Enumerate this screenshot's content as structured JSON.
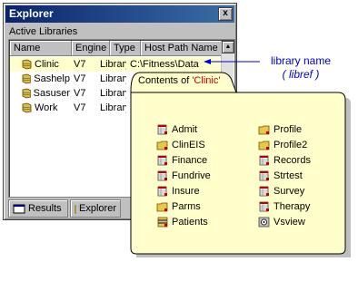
{
  "window": {
    "title": "Explorer",
    "close_glyph": "x",
    "pane_label": "Active Libraries"
  },
  "columns": [
    "Name",
    "Engine",
    "Type",
    "Host Path Name"
  ],
  "libraries": [
    {
      "name": "Clinic",
      "engine": "V7",
      "type": "Library",
      "host_path": "C:\\Fitness\\Data",
      "selected": true
    },
    {
      "name": "Sashelp",
      "engine": "V7",
      "type": "Library",
      "host_path": "",
      "selected": false
    },
    {
      "name": "Sasuser",
      "engine": "V7",
      "type": "Library",
      "host_path": "",
      "selected": false
    },
    {
      "name": "Work",
      "engine": "V7",
      "type": "Library",
      "host_path": "",
      "selected": false
    }
  ],
  "tabs": [
    {
      "label": "Results",
      "icon": "results-icon"
    },
    {
      "label": "Explorer",
      "icon": "explorer-icon"
    }
  ],
  "annotation": {
    "line1": "library name",
    "line2": "( libref )"
  },
  "contents": {
    "tab_prefix": "Contents of ",
    "libname": "'Clinic'",
    "left_column": [
      {
        "name": "Admit",
        "icon": "dataset-icon"
      },
      {
        "name": "ClinEIS",
        "icon": "folder-icon"
      },
      {
        "name": "Finance",
        "icon": "dataset-icon"
      },
      {
        "name": "Fundrive",
        "icon": "dataset-icon"
      },
      {
        "name": "Insure",
        "icon": "dataset-icon"
      },
      {
        "name": "Parms",
        "icon": "folder-icon"
      },
      {
        "name": "Patients",
        "icon": "catalog-icon"
      }
    ],
    "right_column": [
      {
        "name": "Profile",
        "icon": "folder-icon"
      },
      {
        "name": "Profile2",
        "icon": "folder-icon"
      },
      {
        "name": "Records",
        "icon": "dataset-icon"
      },
      {
        "name": "Strtest",
        "icon": "dataset-icon"
      },
      {
        "name": "Survey",
        "icon": "dataset-icon"
      },
      {
        "name": "Therapy",
        "icon": "dataset-icon"
      },
      {
        "name": "Vsview",
        "icon": "view-icon"
      }
    ]
  },
  "colors": {
    "folder_fill": "#ffffcc",
    "annotation_text": "#0000cc",
    "libname_text": "#c00000",
    "titlebar": "#0a246a"
  }
}
